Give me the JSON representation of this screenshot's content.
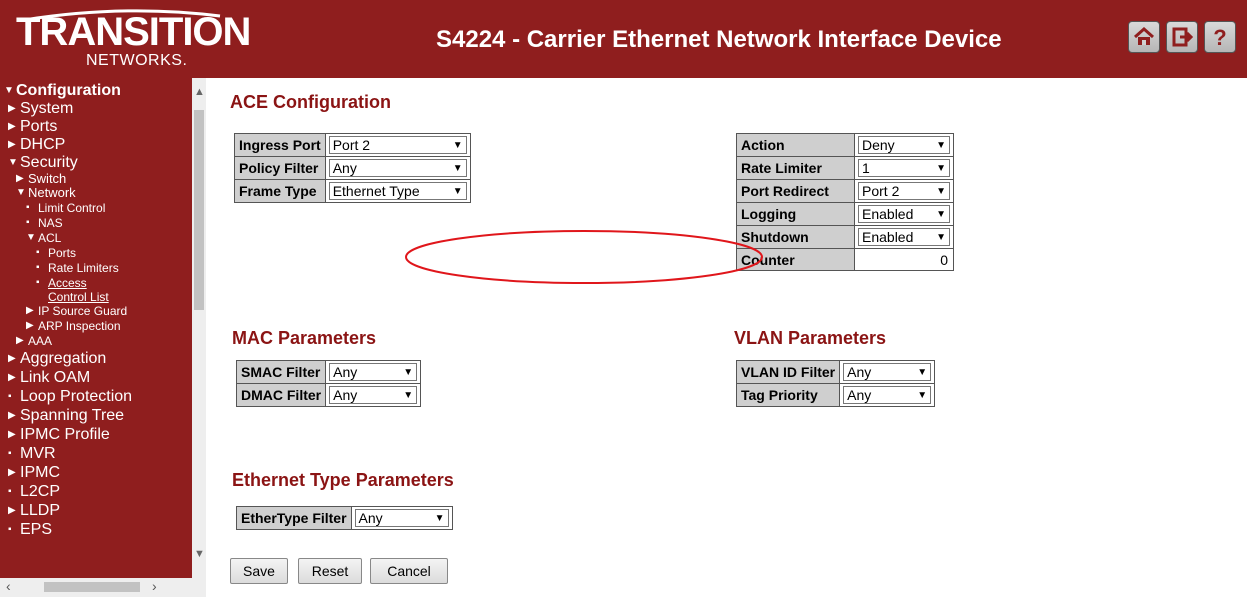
{
  "header": {
    "logo_main": "TRANSITION",
    "logo_sub": "NETWORKS.",
    "title": "S4224 - Carrier Ethernet Network Interface Device",
    "icons": [
      "home-icon",
      "logout-icon",
      "help-icon"
    ]
  },
  "nav": {
    "configuration": "Configuration",
    "system": "System",
    "ports": "Ports",
    "dhcp": "DHCP",
    "security": "Security",
    "switch": "Switch",
    "network": "Network",
    "limit_control": "Limit Control",
    "nas": "NAS",
    "acl": "ACL",
    "acl_ports": "Ports",
    "rate_limiters": "Rate Limiters",
    "access": "Access",
    "control_list": "Control List",
    "ip_source_guard": "IP Source Guard",
    "arp_inspection": "ARP Inspection",
    "aaa": "AAA",
    "aggregation": "Aggregation",
    "link_oam": "Link OAM",
    "loop_protection": "Loop Protection",
    "spanning_tree": "Spanning Tree",
    "ipmc_profile": "IPMC Profile",
    "mvr": "MVR",
    "ipmc": "IPMC",
    "l2cp": "L2CP",
    "lldp": "LLDP",
    "eps": "EPS"
  },
  "ace": {
    "title": "ACE Configuration",
    "ingress_port_label": "Ingress Port",
    "ingress_port_value": "Port 2",
    "policy_filter_label": "Policy Filter",
    "policy_filter_value": "Any",
    "frame_type_label": "Frame Type",
    "frame_type_value": "Ethernet Type",
    "action_label": "Action",
    "action_value": "Deny",
    "rate_limiter_label": "Rate Limiter",
    "rate_limiter_value": "1",
    "port_redirect_label": "Port Redirect",
    "port_redirect_value": "Port 2",
    "logging_label": "Logging",
    "logging_value": "Enabled",
    "shutdown_label": "Shutdown",
    "shutdown_value": "Enabled",
    "counter_label": "Counter",
    "counter_value": "0"
  },
  "mac": {
    "title": "MAC Parameters",
    "smac_label": "SMAC Filter",
    "smac_value": "Any",
    "dmac_label": "DMAC Filter",
    "dmac_value": "Any"
  },
  "vlan": {
    "title": "VLAN Parameters",
    "vid_label": "VLAN ID Filter",
    "vid_value": "Any",
    "prio_label": "Tag Priority",
    "prio_value": "Any"
  },
  "ethertype": {
    "title": "Ethernet Type Parameters",
    "label": "EtherType Filter",
    "value": "Any"
  },
  "buttons": {
    "save": "Save",
    "reset": "Reset",
    "cancel": "Cancel"
  },
  "colors": {
    "brand": "#8f1e1e",
    "section_title": "#8b1414",
    "annotation": "#e0161b"
  }
}
